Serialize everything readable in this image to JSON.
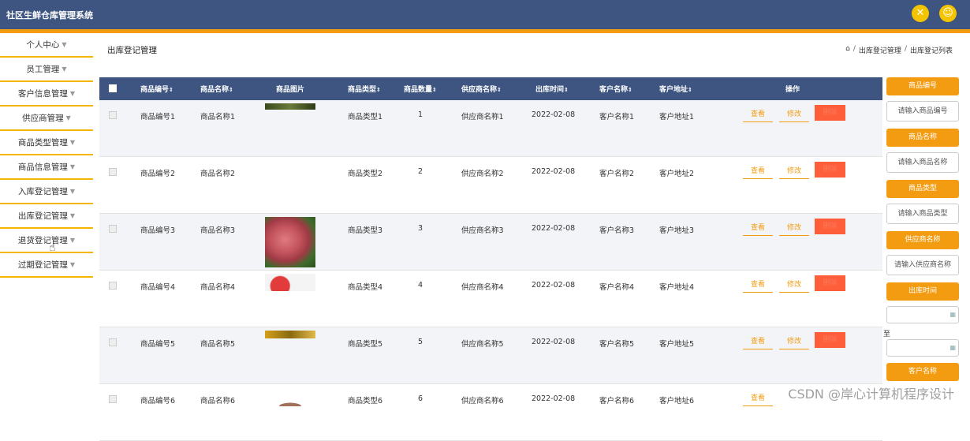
{
  "app": {
    "title": "社区生鲜仓库管理系统"
  },
  "header": {
    "icons": [
      "tools-icon",
      "user-icon"
    ]
  },
  "sidebar": {
    "items": [
      {
        "label": "个人中心"
      },
      {
        "label": "员工管理"
      },
      {
        "label": "客户信息管理"
      },
      {
        "label": "供应商管理"
      },
      {
        "label": "商品类型管理"
      },
      {
        "label": "商品信息管理"
      },
      {
        "label": "入库登记管理"
      },
      {
        "label": "出库登记管理"
      },
      {
        "label": "退货登记管理"
      },
      {
        "label": "过期登记管理"
      }
    ]
  },
  "page": {
    "title": "出库登记管理",
    "breadcrumb": [
      "出库登记管理",
      "出库登记列表"
    ]
  },
  "table": {
    "columns": [
      "商品编号",
      "商品名称",
      "商品图片",
      "商品类型",
      "商品数量",
      "供应商名称",
      "出库时间",
      "客户名称",
      "客户地址",
      "操作"
    ],
    "actions": {
      "view": "查看",
      "edit": "修改",
      "delete": "删除"
    },
    "rows": [
      {
        "code": "商品编号1",
        "name": "商品名称1",
        "type": "商品类型1",
        "qty": "1",
        "supplier": "供应商名称1",
        "time": "2022-02-08",
        "customer": "客户名称1",
        "address": "客户地址1"
      },
      {
        "code": "商品编号2",
        "name": "商品名称2",
        "type": "商品类型2",
        "qty": "2",
        "supplier": "供应商名称2",
        "time": "2022-02-08",
        "customer": "客户名称2",
        "address": "客户地址2"
      },
      {
        "code": "商品编号3",
        "name": "商品名称3",
        "type": "商品类型3",
        "qty": "3",
        "supplier": "供应商名称3",
        "time": "2022-02-08",
        "customer": "客户名称3",
        "address": "客户地址3"
      },
      {
        "code": "商品编号4",
        "name": "商品名称4",
        "type": "商品类型4",
        "qty": "4",
        "supplier": "供应商名称4",
        "time": "2022-02-08",
        "customer": "客户名称4",
        "address": "客户地址4"
      },
      {
        "code": "商品编号5",
        "name": "商品名称5",
        "type": "商品类型5",
        "qty": "5",
        "supplier": "供应商名称5",
        "time": "2022-02-08",
        "customer": "客户名称5",
        "address": "客户地址5"
      },
      {
        "code": "商品编号6",
        "name": "商品名称6",
        "type": "商品类型6",
        "qty": "6",
        "supplier": "供应商名称6",
        "time": "2022-02-08",
        "customer": "客户名称6",
        "address": "客户地址6"
      }
    ]
  },
  "filters": {
    "code_label": "商品编号",
    "code_placeholder": "请输入商品编号",
    "name_label": "商品名称",
    "name_placeholder": "请输入商品名称",
    "type_label": "商品类型",
    "type_placeholder": "请输入商品类型",
    "supplier_label": "供应商名称",
    "supplier_placeholder": "请输入供应商名称",
    "time_label": "出库时间",
    "to_label": "至",
    "customer_label": "客户名称"
  },
  "watermark": "CSDN @岸心计算机程序设计",
  "colors": {
    "header": "#3d5580",
    "accent": "#f39c12",
    "delete": "#ff5e3a"
  }
}
